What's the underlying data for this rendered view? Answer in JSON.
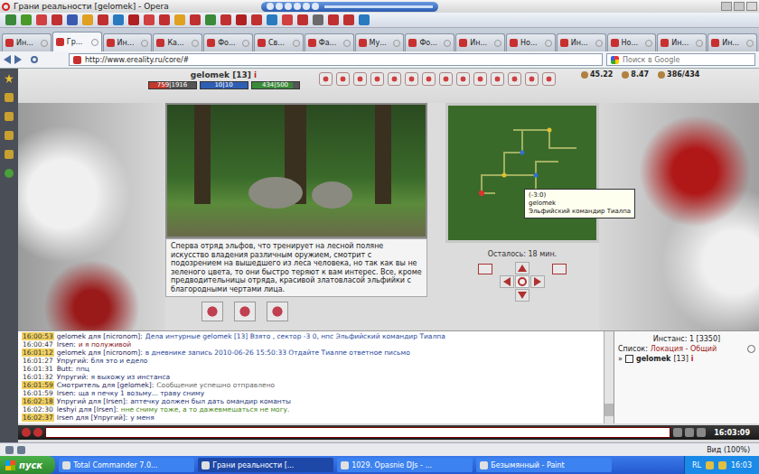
{
  "window": {
    "title": "Грани реальности [gelomek] - Opera"
  },
  "tabs": [
    {
      "label": "Ин...",
      "selected": false
    },
    {
      "label": "Гр...",
      "selected": true
    },
    {
      "label": "Ин...",
      "selected": false
    },
    {
      "label": "Ка...",
      "selected": false
    },
    {
      "label": "Фо...",
      "selected": false
    },
    {
      "label": "Св...",
      "selected": false
    },
    {
      "label": "Фа...",
      "selected": false
    },
    {
      "label": "Му...",
      "selected": false
    },
    {
      "label": "Фо...",
      "selected": false
    },
    {
      "label": "Ин...",
      "selected": false
    },
    {
      "label": "Но...",
      "selected": false
    },
    {
      "label": "Ин...",
      "selected": false
    },
    {
      "label": "Но...",
      "selected": false
    },
    {
      "label": "Ин...",
      "selected": false
    },
    {
      "label": "Ин...",
      "selected": false
    }
  ],
  "address_bar": {
    "url": "http://www.ereality.ru/core/#",
    "search_placeholder": "Поиск в Google"
  },
  "player": {
    "name": "gelomek [13]",
    "info": "i",
    "bars": [
      {
        "reading": "759|1916",
        "level": 0.4,
        "color": "#c0392b"
      },
      {
        "reading": "10|10",
        "level": 1,
        "color": "#2f5fb3"
      },
      {
        "reading": "434|500",
        "level": 0.87,
        "color": "#3a8a3a"
      }
    ],
    "stats": [
      "45.22",
      "8.47",
      "386/434"
    ]
  },
  "location": {
    "description": "Сперва отряд эльфов, что тренирует на лесной поляне искусство владения различным оружием, смотрит с подозрением на вышедшего из леса человека, но так как вы не зеленого цвета, то они быстро теряют к вам интерес. Все, кроме предводительницы отряда, красивой златовласой эльфийки с благородными чертами лица.",
    "time_left": "Осталось: 18 мин."
  },
  "map": {
    "tooltip": {
      "coords": "(-3:0)",
      "player": "gelomek",
      "npc": "Эльфийский командир Тиалпа"
    }
  },
  "chat": {
    "messages": [
      {
        "time": "16:00:53",
        "author": "gelomek для [nicronom]:",
        "text": "Дела интурные gelomek [13] Взято , сектор -3 0, нпс Эльфийский командир Тиалпа",
        "highlighted": true,
        "color": "#2a4aa0"
      },
      {
        "time": "16:00:47",
        "author": "Irsen:",
        "text": "и я полуживой",
        "highlighted": false,
        "color": "#8a1a1a"
      },
      {
        "time": "16:01:12",
        "author": "gelomek для [nicronom]:",
        "text": "в дневнике запись 2010-06-26 15:50:33 Отдайте Тиалпе ответное письмо",
        "highlighted": true,
        "color": "#2a4aa0"
      },
      {
        "time": "16:01:27",
        "author": "Упругий:",
        "text": "бля это и едело",
        "highlighted": false,
        "color": "#2a3a7a"
      },
      {
        "time": "16:01:31",
        "author": "Butt:",
        "text": "ппц",
        "highlighted": false,
        "color": "#2a3a7a"
      },
      {
        "time": "16:01:32",
        "author": "Упругий:",
        "text": "я выхожу из инстанса",
        "highlighted": false,
        "color": "#2a3a7a"
      },
      {
        "time": "16:01:59",
        "author": "Смотритель для [gelomek]:",
        "text": "Сообщение успешно отправлено",
        "highlighted": true,
        "color": "#6a6a6a"
      },
      {
        "time": "16:01:59",
        "author": "Irsen:",
        "text": "ща я печку 1 возьму... траву сниму",
        "highlighted": false,
        "color": "#2a3a7a"
      },
      {
        "time": "16:02:18",
        "author": "Упругий для [Irsen]:",
        "text": "аптечку должен был дать омандир команты",
        "highlighted": true,
        "color": "#2a3a7a"
      },
      {
        "time": "16:02:30",
        "author": "leshyi для [Irsen]:",
        "text": "нне сниму тоже, а то дажевмешаться не могу.",
        "highlighted": false,
        "color": "#4a8a1a"
      },
      {
        "time": "16:02:37",
        "author": "Irsen для [Упругий]:",
        "text": "у меня",
        "highlighted": true,
        "color": "#2a3a7a"
      }
    ]
  },
  "instance": {
    "title": "Инстанс: 1 [3350]",
    "list_label": "Список:",
    "list_value": "Локация - Общий",
    "arrow": "»",
    "players": [
      {
        "name": "gelomek",
        "level": "[13]",
        "info": "i"
      }
    ]
  },
  "game_clock": "16:03:09",
  "status_bar": {
    "zoom": "Вид (100%)"
  },
  "taskbar": {
    "start": "пуск",
    "items": [
      {
        "label": "Total Commander 7.0...",
        "selected": false
      },
      {
        "label": "Грани реальности [...",
        "selected": true
      },
      {
        "label": "1029. Opasnie DJs - ...",
        "selected": false
      },
      {
        "label": "Безымянный - Paint",
        "selected": false
      }
    ],
    "lang": "RL",
    "clock": "16:03"
  }
}
